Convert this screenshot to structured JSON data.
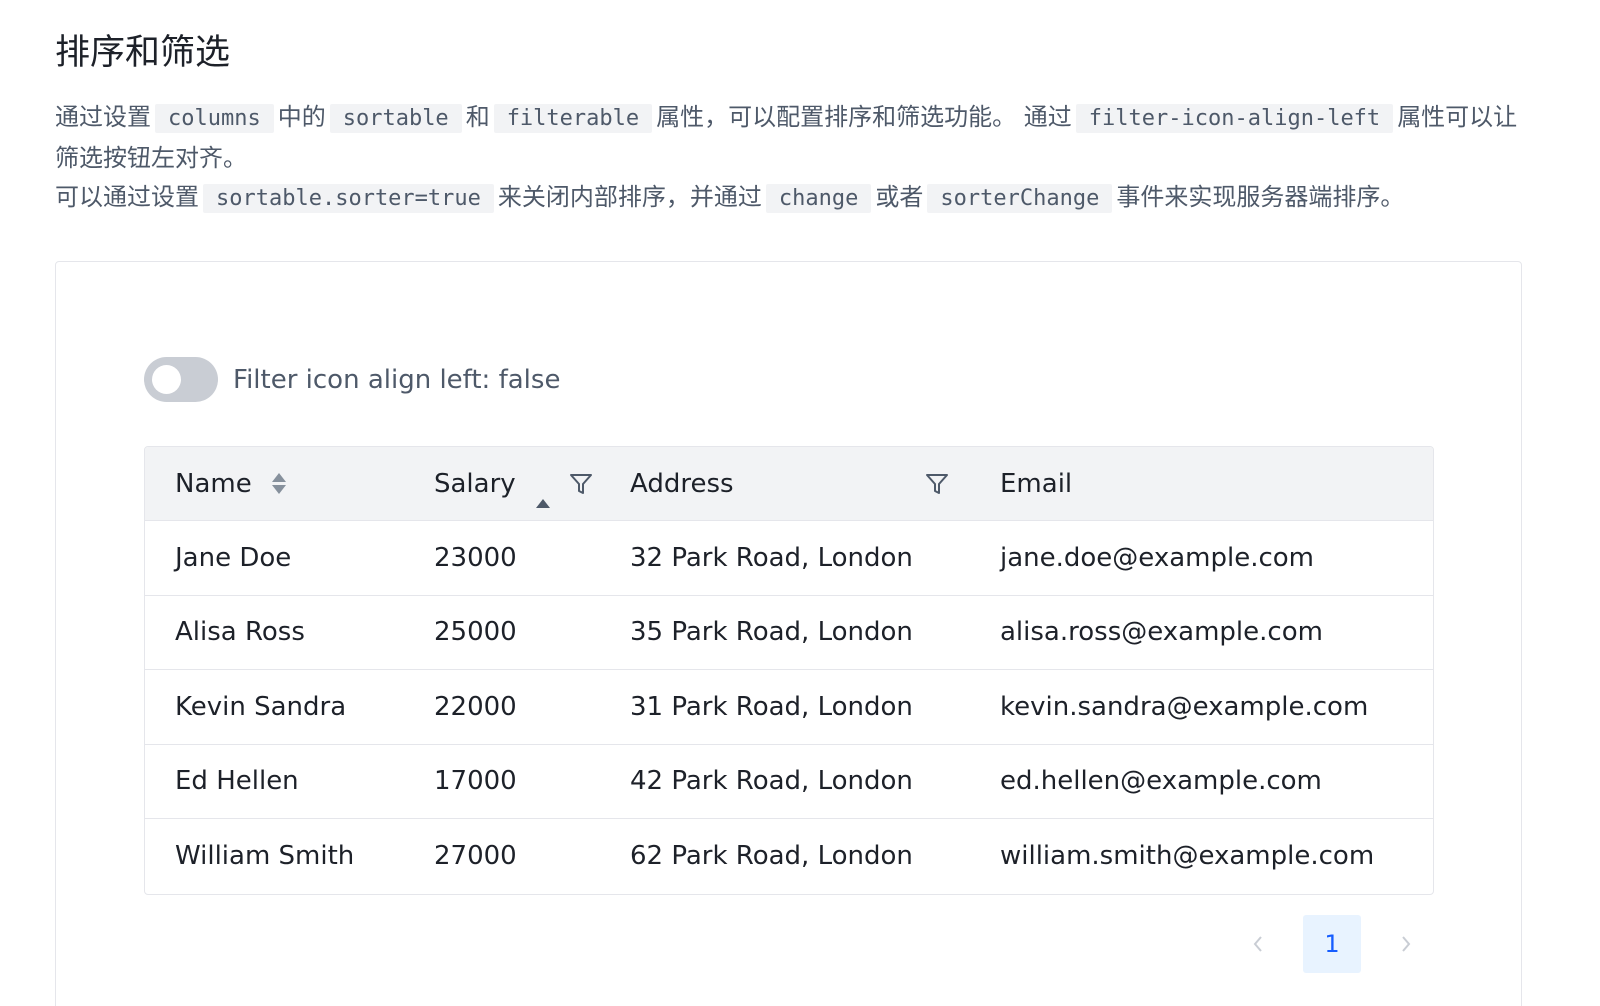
{
  "page": {
    "title": "排序和筛选",
    "desc": {
      "p1_t1": "通过设置",
      "p1_c1": "columns",
      "p1_t2": "中的",
      "p1_c2": "sortable",
      "p1_t3": "和",
      "p1_c3": "filterable",
      "p1_t4": "属性，可以配置排序和筛选功能。 通过",
      "p1_c4": "filter-icon-align-left",
      "p1_t5": "属性可以让筛选按钮左对齐。",
      "p2_t1": "可以通过设置",
      "p2_c1": "sortable.sorter=true",
      "p2_t2": "来关闭内部排序，并通过",
      "p2_c2": "change",
      "p2_t3": "或者",
      "p2_c3": "sorterChange",
      "p2_t4": "事件来实现服务器端排序。"
    }
  },
  "demo": {
    "switch": {
      "checked": false,
      "label": "Filter icon align left: false"
    },
    "table": {
      "headers": {
        "name": "Name",
        "salary": "Salary",
        "address": "Address",
        "email": "Email"
      },
      "sort": {
        "name": "none",
        "salary": "ascend"
      },
      "rows": [
        {
          "name": "Jane Doe",
          "salary": "23000",
          "address": "32 Park Road, London",
          "email": "jane.doe@example.com"
        },
        {
          "name": "Alisa Ross",
          "salary": "25000",
          "address": "35 Park Road, London",
          "email": "alisa.ross@example.com"
        },
        {
          "name": "Kevin Sandra",
          "salary": "22000",
          "address": "31 Park Road, London",
          "email": "kevin.sandra@example.com"
        },
        {
          "name": "Ed Hellen",
          "salary": "17000",
          "address": "42 Park Road, London",
          "email": "ed.hellen@example.com"
        },
        {
          "name": "William Smith",
          "salary": "27000",
          "address": "62 Park Road, London",
          "email": "william.smith@example.com"
        }
      ]
    },
    "pagination": {
      "prev_icon": "chevron-left-icon",
      "current_page": "1",
      "next_icon": "chevron-right-icon"
    }
  },
  "colors": {
    "text_primary": "#1d2129",
    "text_secondary": "#4e5969",
    "header_bg": "#f2f3f5",
    "border": "#e5e6eb",
    "switch_off": "#c9cdd4",
    "primary": "#165dff",
    "page_active_bg": "#e8f3ff"
  }
}
